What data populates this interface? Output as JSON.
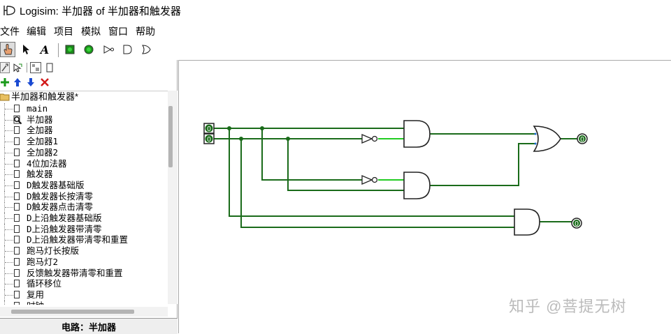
{
  "window": {
    "title": "Logisim: 半加器 of 半加器和触发器"
  },
  "menu": [
    "文件",
    "编辑",
    "项目",
    "模拟",
    "窗口",
    "帮助"
  ],
  "toolbar": {
    "tools": [
      "hand-poke-icon",
      "select-arrow-icon",
      "text-tool-icon",
      "input-pin-icon",
      "output-pin-icon",
      "not-gate-icon",
      "and-gate-icon",
      "or-gate-icon"
    ]
  },
  "explorer_tools": [
    "wrench-icon",
    "pointer-tree-icon",
    "layout-icon",
    "appearance-icon"
  ],
  "project_tools": [
    "add-circuit-icon",
    "move-up-icon",
    "move-down-icon",
    "delete-circuit-icon"
  ],
  "tree": {
    "root": "半加器和触发器*",
    "items": [
      "main",
      "半加器",
      "全加器",
      "全加器1",
      "全加器2",
      "4位加法器",
      "触发器",
      "D触发器基础版",
      "D触发器长按清零",
      "D触发器点击清零",
      "D上沿触发器基础版",
      "D上沿触发器带清零",
      "D上沿触发器带清零和重置",
      "跑马灯长按版",
      "跑马灯2",
      "反馈触发器带清零和重置",
      "循环移位",
      "复用",
      "时钟"
    ]
  },
  "status": {
    "label": "电路：半加器"
  },
  "circuit": {
    "inputs": [
      "0",
      "0"
    ],
    "outputs": [
      "0",
      "0"
    ],
    "colors": {
      "wire": "#1a6b1a",
      "wire_active": "#22cc22",
      "pin_value": "#006400"
    }
  },
  "watermark": "知乎 @菩提无树"
}
